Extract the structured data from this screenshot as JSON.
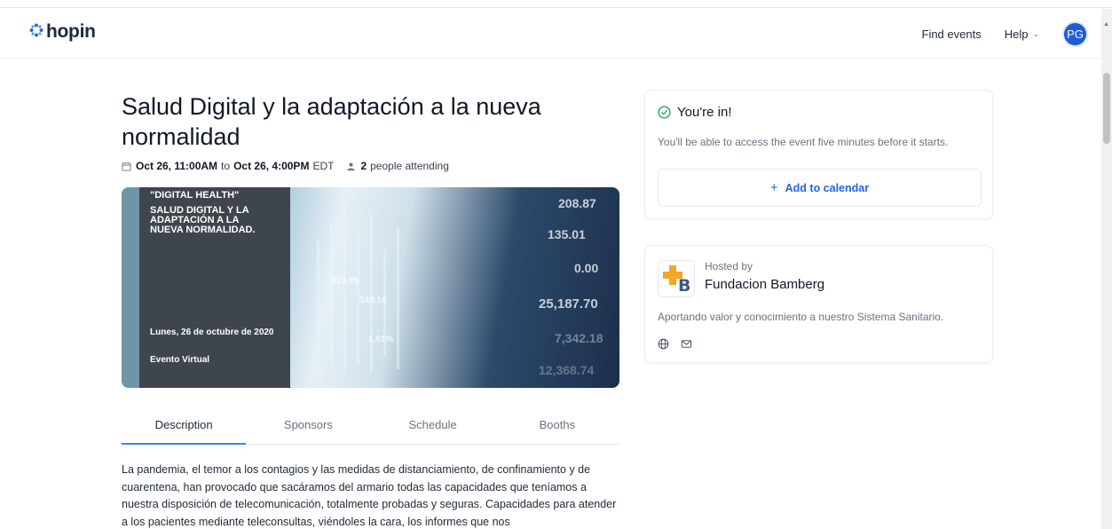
{
  "brand": {
    "name": "hopin",
    "icon": "hopin-logo-icon"
  },
  "nav": {
    "find_events": "Find events",
    "help": "Help",
    "avatar_initials": "PG"
  },
  "event": {
    "title": "Salud Digital y la adaptación a la nueva normalidad",
    "start": "Oct 26, 11:00AM",
    "to": "to",
    "end": "Oct 26, 4:00PM",
    "timezone": "EDT",
    "attending_count": "2",
    "attending_label": "people attending"
  },
  "banner": {
    "heading": "\"DIGITAL HEALTH\"",
    "subheading": "SALUD DIGITAL Y LA ADAPTACIÓN A LA NUEVA NORMALIDAD.",
    "date": "Lunes, 26 de octubre de 2020",
    "mode": "Evento Virtual",
    "numbers": [
      "208.87",
      "135.01",
      "0.00",
      "25,187.70",
      "210.95",
      "149.16",
      "1.61%",
      "7,342.18",
      "12,368.74"
    ]
  },
  "tabs": [
    {
      "label": "Description",
      "active": true
    },
    {
      "label": "Sponsors",
      "active": false
    },
    {
      "label": "Schedule",
      "active": false
    },
    {
      "label": "Booths",
      "active": false
    }
  ],
  "description": "La pandemia, el temor a los contagios y las medidas de distanciamiento, de confinamiento y de cuarentena, han provocado que sacáramos del armario todas las capacidades que teníamos a nuestra disposición de telecomunicación, totalmente probadas y seguras. Capacidades para atender a los pacientes mediante teleconsultas, viéndoles la cara, los informes que nos",
  "registration": {
    "status": "You're in!",
    "note": "You'll be able to access the event five minutes before it starts.",
    "calendar_button": "Add to calendar"
  },
  "host": {
    "hosted_by": "Hosted by",
    "name": "Fundacion Bamberg",
    "description": "Aportando valor y conocimiento a nuestro Sistema Sanitario."
  },
  "colors": {
    "accent": "#2563eb",
    "avatar": "#1f5bd9",
    "success": "#22a05b",
    "host_cross": "#f5a623"
  }
}
